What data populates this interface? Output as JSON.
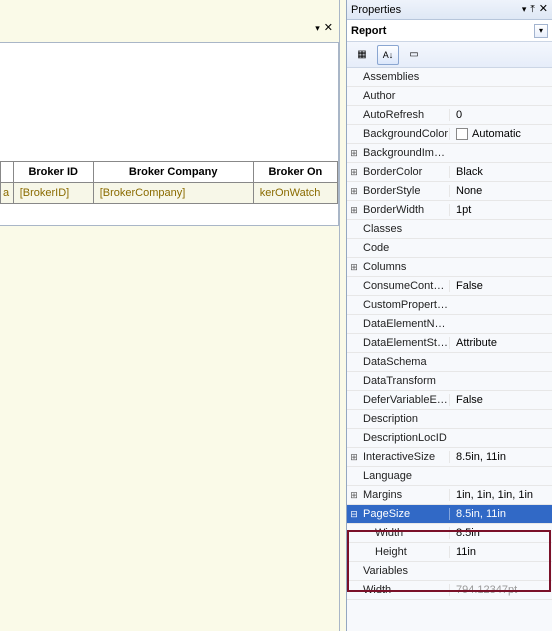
{
  "designer": {
    "columns": [
      "Broker ID",
      "Broker Company",
      "Broker On"
    ],
    "cells_prefix": "a",
    "cells": [
      "[BrokerID]",
      "[BrokerCompany]",
      "kerOnWatch"
    ]
  },
  "properties_panel": {
    "title": "Properties",
    "selector": "Report",
    "toolbar": {
      "cat_icon": "category-icon",
      "sort_icon": "sort-az-icon",
      "pages_icon": "property-pages-icon"
    },
    "rows": [
      {
        "name": "Assemblies",
        "value": "",
        "expand": null
      },
      {
        "name": "Author",
        "value": "",
        "expand": null
      },
      {
        "name": "AutoRefresh",
        "value": "0",
        "expand": null
      },
      {
        "name": "BackgroundColor",
        "value": "Automatic",
        "expand": null,
        "swatch": true
      },
      {
        "name": "BackgroundImage",
        "value": "",
        "expand": "+"
      },
      {
        "name": "BorderColor",
        "value": "Black",
        "expand": "+"
      },
      {
        "name": "BorderStyle",
        "value": "None",
        "expand": "+"
      },
      {
        "name": "BorderWidth",
        "value": "1pt",
        "expand": "+"
      },
      {
        "name": "Classes",
        "value": "",
        "expand": null
      },
      {
        "name": "Code",
        "value": "",
        "expand": null
      },
      {
        "name": "Columns",
        "value": "",
        "expand": "+"
      },
      {
        "name": "ConsumeContainerWhitespace",
        "value": "False",
        "expand": null
      },
      {
        "name": "CustomProperties",
        "value": "",
        "expand": null
      },
      {
        "name": "DataElementName",
        "value": "",
        "expand": null
      },
      {
        "name": "DataElementStyle",
        "value": "Attribute",
        "expand": null
      },
      {
        "name": "DataSchema",
        "value": "",
        "expand": null
      },
      {
        "name": "DataTransform",
        "value": "",
        "expand": null
      },
      {
        "name": "DeferVariableEvaluation",
        "value": "False",
        "expand": null
      },
      {
        "name": "Description",
        "value": "",
        "expand": null
      },
      {
        "name": "DescriptionLocID",
        "value": "",
        "expand": null
      },
      {
        "name": "InteractiveSize",
        "value": "8.5in, 11in",
        "expand": "+"
      },
      {
        "name": "Language",
        "value": "",
        "expand": null
      },
      {
        "name": "Margins",
        "value": "1in, 1in, 1in, 1in",
        "expand": "+"
      }
    ],
    "pagesize": {
      "name": "PageSize",
      "value": "8.5in, 11in",
      "children": [
        {
          "name": "Width",
          "value": "8.5in"
        },
        {
          "name": "Height",
          "value": "11in"
        }
      ]
    },
    "after": [
      {
        "name": "Variables",
        "value": "",
        "expand": null
      },
      {
        "name": "Width",
        "value": "794.12347pt",
        "expand": null,
        "disabled": true
      }
    ]
  }
}
